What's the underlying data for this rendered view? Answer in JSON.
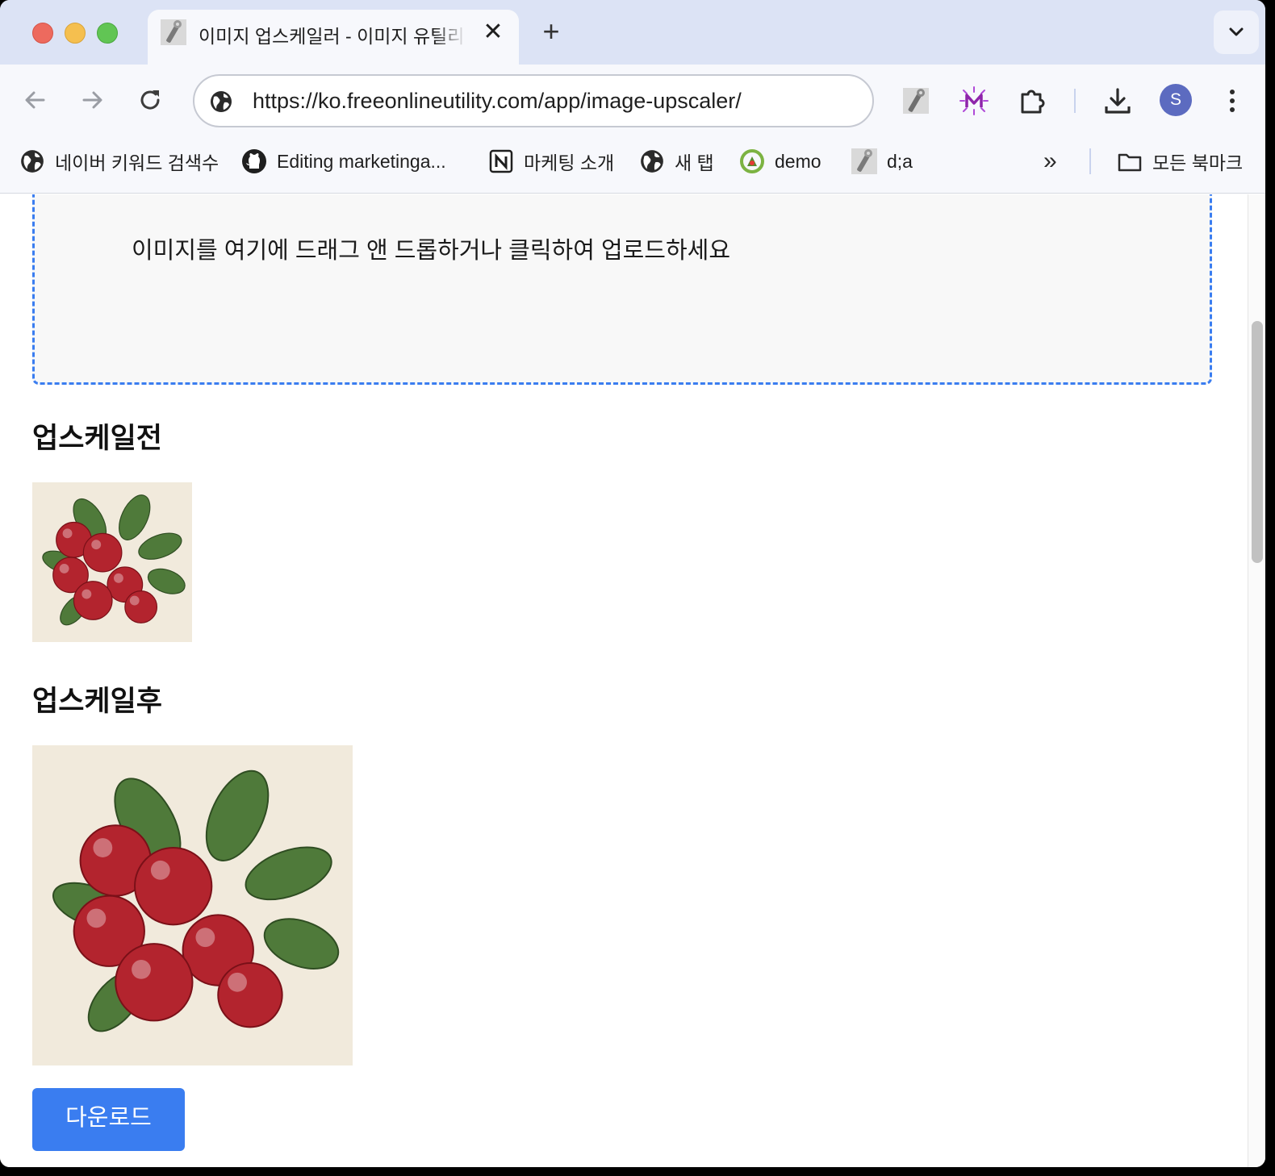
{
  "browser": {
    "tab": {
      "title": "이미지 업스케일러 - 이미지 유틸리티",
      "close_glyph": "✕",
      "favicon": "wrench-icon"
    },
    "new_tab_glyph": "+",
    "address_bar": {
      "url": "https://ko.freeonlineutility.com/app/image-upscaler/",
      "site_icon": "globe-icon"
    },
    "profile_initial": "S",
    "bookmarks": [
      {
        "label": "네이버 키워드 검색수",
        "icon": "globe-icon"
      },
      {
        "label": "Editing marketinga...",
        "icon": "github-icon"
      },
      {
        "label": "마케팅 소개",
        "icon": "notion-icon"
      },
      {
        "label": "새 탭",
        "icon": "globe-icon"
      },
      {
        "label": "demo",
        "icon": "demo-icon"
      },
      {
        "label": "d;a",
        "icon": "wrench-icon"
      }
    ],
    "overflow_glyph": "»",
    "all_bookmarks_label": "모든 북마크"
  },
  "page": {
    "dropzone_text": "이미지를 여기에 드래그 앤 드롭하거나 클릭하여 업로드하세요",
    "before_title": "업스케일전",
    "after_title": "업스케일후",
    "download_label": "다운로드"
  }
}
